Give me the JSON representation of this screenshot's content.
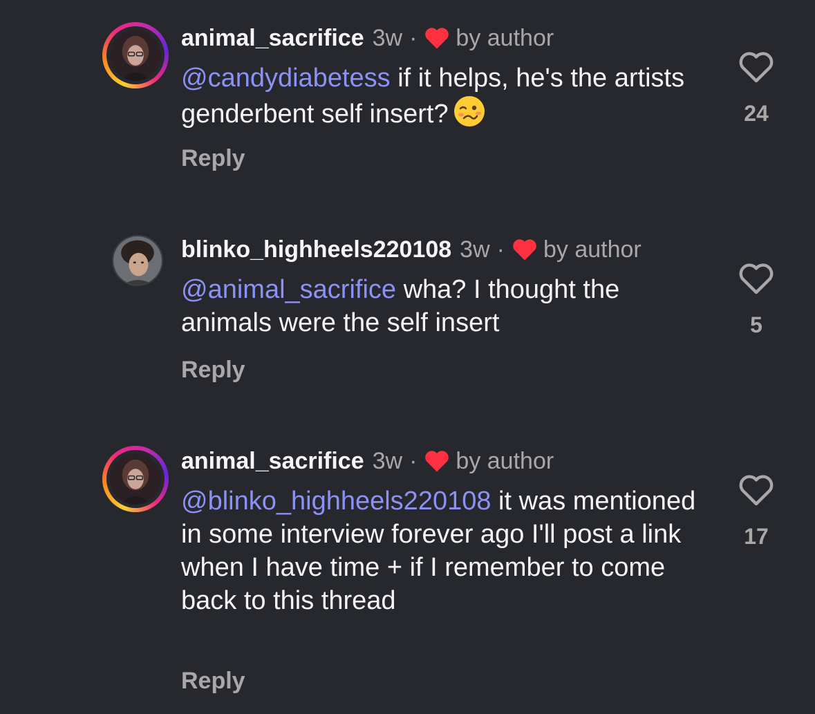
{
  "colors": {
    "background": "#26282d",
    "text": "#f5f5f5",
    "muted": "#a8a8a8",
    "mention": "#8c91f5",
    "heart": "#ff3040"
  },
  "comments": [
    {
      "username": "animal_sacrifice",
      "time": "3w",
      "separator": "·",
      "author_badge": "by author",
      "mention": "@candydiabetess",
      "text": " if it helps, he's the artists genderbent self insert?",
      "emoji": "woozy-face",
      "reply_label": "Reply",
      "likes": "24",
      "has_story_ring": true
    },
    {
      "username": "blinko_highheels220108",
      "time": "3w",
      "separator": "·",
      "author_badge": "by author",
      "mention": "@animal_sacrifice",
      "text": " wha? I thought the animals were the self insert",
      "reply_label": "Reply",
      "likes": "5",
      "has_story_ring": false
    },
    {
      "username": "animal_sacrifice",
      "time": "3w",
      "separator": "·",
      "author_badge": "by author",
      "mention": "@blinko_highheels220108",
      "text": " it was mentioned in some interview forever ago I'll post a link when I have time + if I remember to come back to this thread",
      "reply_label": "Reply",
      "likes": "17",
      "has_story_ring": true
    }
  ]
}
